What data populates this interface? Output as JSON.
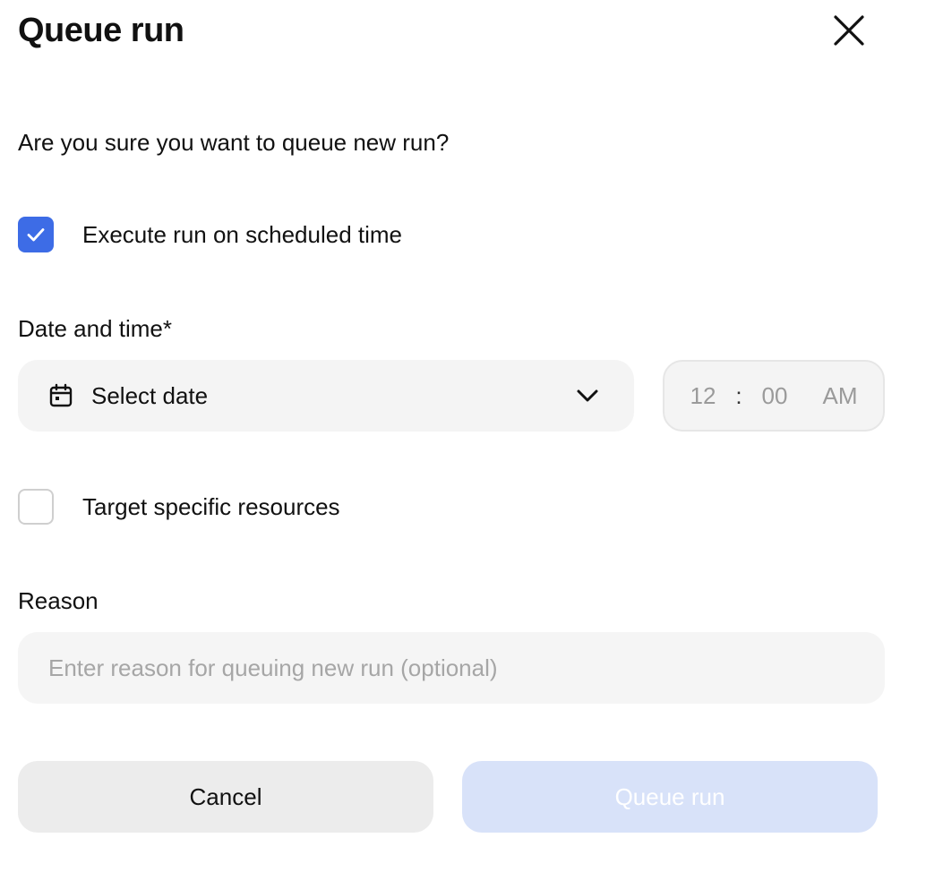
{
  "dialog": {
    "title": "Queue run",
    "question": "Are you sure you want to queue new run?"
  },
  "execute_scheduled": {
    "label": "Execute run on scheduled time",
    "checked": true
  },
  "date_time": {
    "label": "Date and time*",
    "date_placeholder": "Select date",
    "hour": "12",
    "separator": ":",
    "minute": "00",
    "period": "AM"
  },
  "target_resources": {
    "label": "Target specific resources",
    "checked": false
  },
  "reason": {
    "label": "Reason",
    "placeholder": "Enter reason for queuing new run (optional)",
    "value": ""
  },
  "actions": {
    "cancel_label": "Cancel",
    "submit_label": "Queue run"
  },
  "colors": {
    "accent": "#3d6ce6",
    "submit_disabled_bg": "#d8e2f9",
    "field_bg": "#f4f4f4"
  },
  "icons": {
    "close": "close-icon",
    "check": "check-icon",
    "calendar": "calendar-icon",
    "dropdown": "chevron-down-icon"
  }
}
